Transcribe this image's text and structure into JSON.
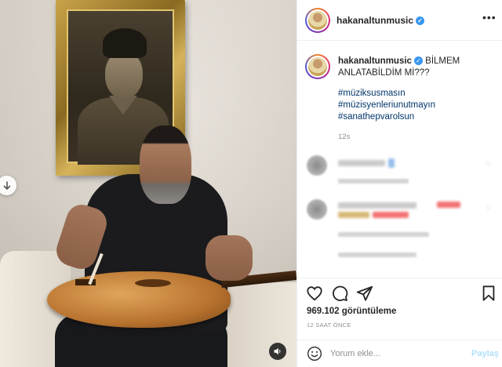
{
  "post": {
    "username": "hakanaltunmusic",
    "caption": "BİLMEM ANLATABİLDİM Mİ???",
    "hashtags": [
      "#müziksusmasın",
      "#müzisyenleriunutmayın",
      "#sanathepvarolsun"
    ],
    "caption_time": "12s"
  },
  "stats": {
    "views": "969.102 görüntüleme",
    "time_ago": "12 SAAT ÖNCE"
  },
  "comment_box": {
    "placeholder": "Yorum ekle...",
    "post_label": "Paylaş"
  },
  "icons": {
    "more": "more-options-icon",
    "verified": "verified-badge-icon",
    "like": "heart-icon",
    "comment": "comment-icon",
    "share": "send-icon",
    "save": "bookmark-icon",
    "emoji": "smiley-icon",
    "scroll": "arrow-down-icon",
    "sound": "speaker-icon"
  },
  "colors": {
    "hashtag": "#003569",
    "verified": "#3897f0",
    "post_button_disabled": "#b2dffc"
  }
}
